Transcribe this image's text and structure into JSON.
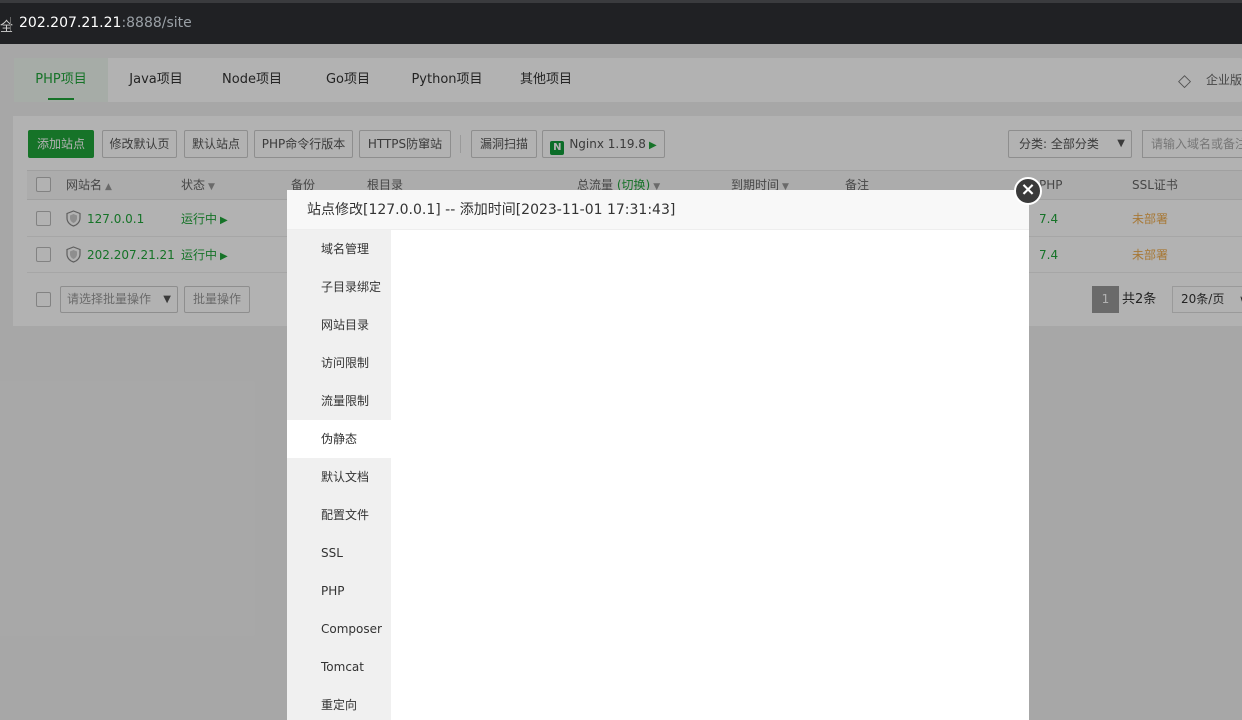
{
  "browser": {
    "url_host": "202.207.21.21",
    "url_rest": ":8888/site"
  },
  "tabs": [
    {
      "label": "PHP项目"
    },
    {
      "label": "Java项目"
    },
    {
      "label": "Node项目"
    },
    {
      "label": "Go项目"
    },
    {
      "label": "Python项目"
    },
    {
      "label": "其他项目"
    }
  ],
  "enterprise_label": "企业版",
  "toolbar": {
    "add_site": "添加站点",
    "edit_default_page": "修改默认页",
    "default_site": "默认站点",
    "php_cli": "PHP命令行版本",
    "https_guard": "HTTPS防窜站",
    "vuln_scan": "漏洞扫描",
    "nginx": "Nginx 1.19.8",
    "category": "分类: 全部分类",
    "search_placeholder": "请输入域名或备注"
  },
  "table": {
    "headers": {
      "name": "网站名",
      "status": "状态",
      "backup": "备份",
      "root": "根目录",
      "traffic": "总流量",
      "switch": "(切换)",
      "expire": "到期时间",
      "remark": "备注",
      "php": "PHP",
      "ssl": "SSL证书"
    },
    "rows": [
      {
        "name": "127.0.0.1",
        "status": "运行中",
        "php": "7.4",
        "ssl": "未部署"
      },
      {
        "name": "202.207.21.21",
        "status": "运行中",
        "php": "7.4",
        "ssl": "未部署"
      }
    ]
  },
  "batch": {
    "select_placeholder": "请选择批量操作",
    "button": "批量操作"
  },
  "pager": {
    "current": "1",
    "total": "共2条",
    "size": "20条/页"
  },
  "modal": {
    "title": "站点修改[127.0.0.1] -- 添加时间[2023-11-01 17:31:43]",
    "close": "×",
    "menu": [
      {
        "label": "域名管理"
      },
      {
        "label": "子目录绑定"
      },
      {
        "label": "网站目录"
      },
      {
        "label": "访问限制"
      },
      {
        "label": "流量限制"
      },
      {
        "label": "伪静态"
      },
      {
        "label": "默认文档"
      },
      {
        "label": "配置文件"
      },
      {
        "label": "SSL"
      },
      {
        "label": "PHP"
      },
      {
        "label": "Composer"
      },
      {
        "label": "Tomcat"
      },
      {
        "label": "重定向"
      }
    ],
    "active_index": 5
  },
  "colors": {
    "accent": "#20a53a",
    "warning": "#f0ad4e"
  }
}
